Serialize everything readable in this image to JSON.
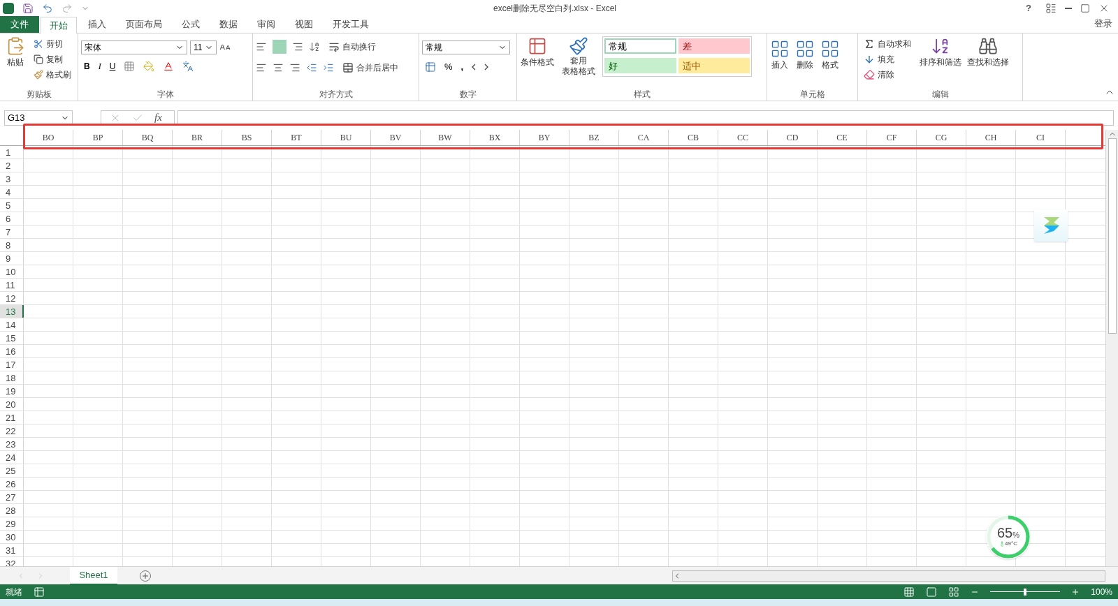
{
  "title_bar": {
    "title": "excel删除无尽空白列.xlsx - Excel",
    "help": "?"
  },
  "tabs": [
    {
      "label": "文件",
      "kind": "file",
      "selected": false
    },
    {
      "label": "开始",
      "kind": "tab",
      "selected": true
    },
    {
      "label": "插入",
      "kind": "tab",
      "selected": false
    },
    {
      "label": "页面布局",
      "kind": "tab",
      "selected": false
    },
    {
      "label": "公式",
      "kind": "tab",
      "selected": false
    },
    {
      "label": "数据",
      "kind": "tab",
      "selected": false
    },
    {
      "label": "审阅",
      "kind": "tab",
      "selected": false
    },
    {
      "label": "视图",
      "kind": "tab",
      "selected": false
    },
    {
      "label": "开发工具",
      "kind": "tab",
      "selected": false
    }
  ],
  "sign_in": "登录",
  "clipboard": {
    "label": "剪贴板",
    "paste": "粘贴",
    "cut": "剪切",
    "copy": "复制",
    "painter": "格式刷"
  },
  "font": {
    "label": "字体",
    "name": "宋体",
    "size": "11",
    "bold": "B",
    "italic": "I",
    "underline": "U"
  },
  "alignment": {
    "label": "对齐方式",
    "wrap": "自动换行",
    "merge": "合并后居中"
  },
  "number": {
    "label": "数字",
    "format": "常规",
    "percent": "%",
    "comma": ","
  },
  "styles": {
    "label": "样式",
    "conditional": "条件格式",
    "table_line1": "套用",
    "table_line2": "表格格式",
    "cell_styles": [
      {
        "label": "常规",
        "kind": "normal",
        "color": "#ffffff",
        "selected": true
      },
      {
        "label": "差",
        "kind": "bad",
        "color": "#ffc7ce",
        "selected": false
      },
      {
        "label": "好",
        "kind": "good",
        "color": "#c6efce",
        "selected": false
      },
      {
        "label": "适中",
        "kind": "neutral",
        "color": "#ffeb9c",
        "selected": false
      }
    ]
  },
  "cells": {
    "label": "单元格",
    "insert": "插入",
    "delete": "删除",
    "format": "格式"
  },
  "editing": {
    "label": "编辑",
    "autosum": "自动求和",
    "fill": "填充",
    "clear": "清除",
    "sort": "排序和筛选",
    "find": "查找和选择"
  },
  "formula_bar": {
    "name_box": "G13",
    "fx": "fx"
  },
  "columns": [
    "BO",
    "BP",
    "BQ",
    "BR",
    "BS",
    "BT",
    "BU",
    "BV",
    "BW",
    "BX",
    "BY",
    "BZ",
    "CA",
    "CB",
    "CC",
    "CD",
    "CE",
    "CF",
    "CG",
    "CH",
    "CI"
  ],
  "rows": [
    {
      "label": "1",
      "selected": false
    },
    {
      "label": "2",
      "selected": false
    },
    {
      "label": "3",
      "selected": false
    },
    {
      "label": "4",
      "selected": false
    },
    {
      "label": "5",
      "selected": false
    },
    {
      "label": "6",
      "selected": false
    },
    {
      "label": "7",
      "selected": false
    },
    {
      "label": "8",
      "selected": false
    },
    {
      "label": "9",
      "selected": false
    },
    {
      "label": "10",
      "selected": false
    },
    {
      "label": "11",
      "selected": false
    },
    {
      "label": "12",
      "selected": false
    },
    {
      "label": "13",
      "selected": true
    },
    {
      "label": "14",
      "selected": false
    },
    {
      "label": "15",
      "selected": false
    },
    {
      "label": "16",
      "selected": false
    },
    {
      "label": "17",
      "selected": false
    },
    {
      "label": "18",
      "selected": false
    },
    {
      "label": "19",
      "selected": false
    },
    {
      "label": "20",
      "selected": false
    },
    {
      "label": "21",
      "selected": false
    },
    {
      "label": "22",
      "selected": false
    },
    {
      "label": "23",
      "selected": false
    },
    {
      "label": "24",
      "selected": false
    },
    {
      "label": "25",
      "selected": false
    },
    {
      "label": "26",
      "selected": false
    },
    {
      "label": "27",
      "selected": false
    },
    {
      "label": "28",
      "selected": false
    },
    {
      "label": "29",
      "selected": false
    },
    {
      "label": "30",
      "selected": false
    },
    {
      "label": "31",
      "selected": false
    },
    {
      "label": "32",
      "selected": false
    }
  ],
  "sheet_tabs": [
    {
      "label": "Sheet1",
      "selected": true
    }
  ],
  "status_bar": {
    "status": "就绪",
    "zoom": "100%",
    "zoom_slider": {
      "level": 0.5
    }
  },
  "monitor_widget": {
    "value": "65",
    "unit": "%",
    "temperature": "49°C",
    "level": 0.65
  }
}
